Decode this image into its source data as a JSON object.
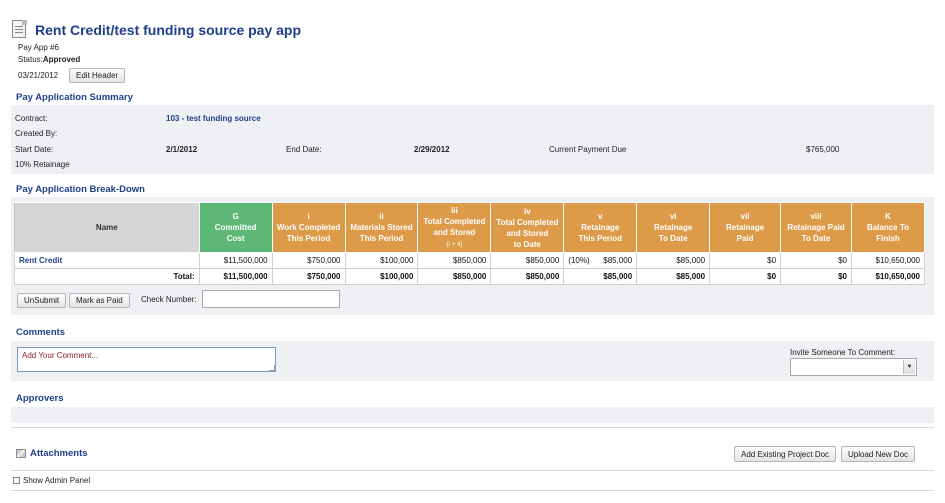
{
  "header": {
    "title": "Rent Credit/test funding source pay app",
    "pay_app_number": "Pay App #6",
    "status_label": "Status:",
    "status_value": "Approved",
    "date": "03/21/2012",
    "edit_header_label": "Edit Header"
  },
  "summary": {
    "section_title": "Pay Application Summary",
    "contract_label": "Contract:",
    "contract_value": "103 - test funding source",
    "created_by_label": "Created By:",
    "start_date_label": "Start Date:",
    "start_date_value": "2/1/2012",
    "end_date_label": "End Date:",
    "end_date_value": "2/29/2012",
    "current_payment_label": "Current Payment Due",
    "current_payment_value": "$765,000",
    "retainage_label": "10% Retainage"
  },
  "breakdown": {
    "section_title": "Pay Application Break-Down",
    "columns": [
      {
        "key": "",
        "line1": "Name",
        "line2": "",
        "line3": "",
        "sub": ""
      },
      {
        "key": "G",
        "line1": "Committed",
        "line2": "Cost",
        "line3": "",
        "sub": ""
      },
      {
        "key": "i",
        "line1": "Work Completed",
        "line2": "This Period",
        "line3": "",
        "sub": ""
      },
      {
        "key": "ii",
        "line1": "Materials Stored",
        "line2": "This Period",
        "line3": "",
        "sub": ""
      },
      {
        "key": "iii",
        "line1": "Total Completed",
        "line2": "and Stored",
        "line3": "",
        "sub": "(i + ii)"
      },
      {
        "key": "iv",
        "line1": "Total Completed",
        "line2": "and Stored",
        "line3": "to Date",
        "sub": ""
      },
      {
        "key": "v",
        "line1": "Retainage",
        "line2": "This Period",
        "line3": "",
        "sub": ""
      },
      {
        "key": "vi",
        "line1": "Retainage",
        "line2": "To Date",
        "line3": "",
        "sub": ""
      },
      {
        "key": "vii",
        "line1": "Retainage",
        "line2": "Paid",
        "line3": "",
        "sub": ""
      },
      {
        "key": "viii",
        "line1": "Retainage Paid",
        "line2": "To Date",
        "line3": "",
        "sub": ""
      },
      {
        "key": "K",
        "line1": "Balance To",
        "line2": "Finish",
        "line3": "",
        "sub": ""
      }
    ],
    "rows": [
      {
        "name": "Rent Credit",
        "committed": "$11,500,000",
        "work_completed": "$750,000",
        "materials_stored": "$100,000",
        "total_completed": "$850,000",
        "total_to_date": "$850,000",
        "retainage_pct": "(10%)",
        "retainage_period": "$85,000",
        "retainage_to_date": "$85,000",
        "retainage_paid": "$0",
        "retainage_paid_to_date": "$0",
        "balance": "$10,650,000"
      }
    ],
    "total": {
      "label": "Total:",
      "committed": "$11,500,000",
      "work_completed": "$750,000",
      "materials_stored": "$100,000",
      "total_completed": "$850,000",
      "total_to_date": "$850,000",
      "retainage_period": "$85,000",
      "retainage_to_date": "$85,000",
      "retainage_paid": "$0",
      "retainage_paid_to_date": "$0",
      "balance": "$10,650,000"
    },
    "unsubmit_label": "UnSubmit",
    "mark_paid_label": "Mark as Paid",
    "check_number_label": "Check Number:",
    "check_number_value": ""
  },
  "comments": {
    "section_title": "Comments",
    "placeholder": "Add Your Comment...",
    "invite_label": "Invite Someone To Comment:",
    "invite_selected": ""
  },
  "approvers": {
    "section_title": "Approvers"
  },
  "attachments": {
    "section_title": "Attachments",
    "add_existing_label": "Add Existing Project Doc",
    "upload_label": "Upload New Doc"
  },
  "admin": {
    "show_admin_label": "Show Admin Panel"
  },
  "colors": {
    "title_blue": "#1f3f8a",
    "committed_green": "#5db876",
    "column_orange": "#dd9b49",
    "band_gray": "#eef0f4"
  },
  "icons": [
    "document-icon",
    "attachment-icon",
    "chevron-down-icon"
  ]
}
